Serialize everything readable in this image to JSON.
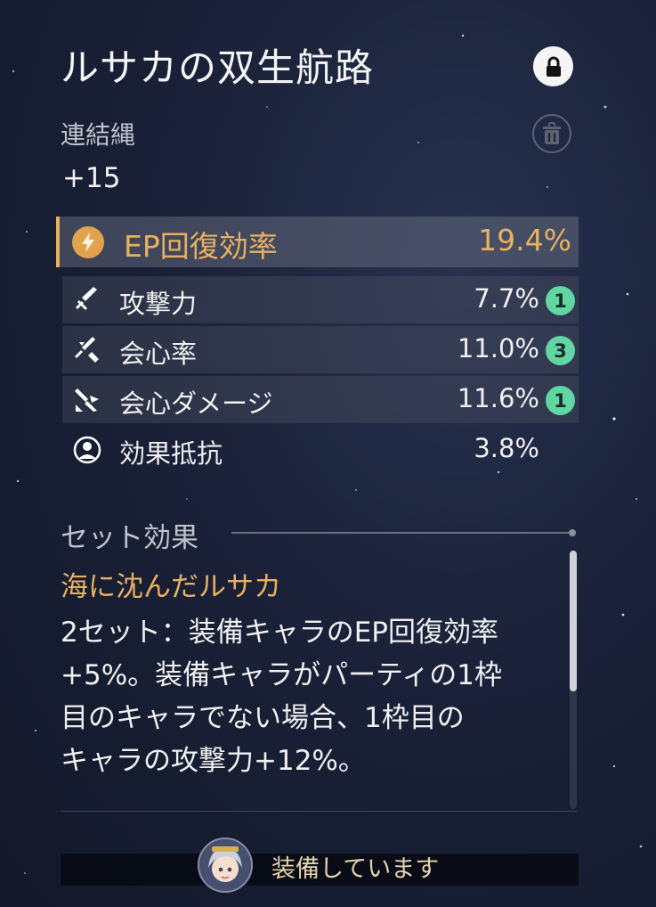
{
  "relic": {
    "title": "ルサカの双生航路",
    "type": "連結縄",
    "level": "+15",
    "locked": true
  },
  "main_stat": {
    "icon": "ep-regen-icon",
    "name": "EP回復効率",
    "value": "19.4%"
  },
  "sub_stats": [
    {
      "icon": "atk-icon",
      "name": "攻撃力",
      "value": "7.7%",
      "rolls": "1"
    },
    {
      "icon": "crit-rate-icon",
      "name": "会心率",
      "value": "11.0%",
      "rolls": "3"
    },
    {
      "icon": "crit-dmg-icon",
      "name": "会心ダメージ",
      "value": "11.6%",
      "rolls": "1"
    },
    {
      "icon": "effect-res-icon",
      "name": "効果抵抗",
      "value": "3.8%",
      "rolls": ""
    }
  ],
  "set_effect": {
    "header": "セット効果",
    "name": "海に沈んだルサカ",
    "description": "2セット：装備キャラのEP回復効率\n+5%。装備キャラがパーティの1枠\n目のキャラでない場合、1枠目の\nキャラの攻撃力+12%。"
  },
  "equipped_label": "装備しています",
  "colors": {
    "accent": "#e9b15f",
    "badge": "#61d5a2"
  }
}
